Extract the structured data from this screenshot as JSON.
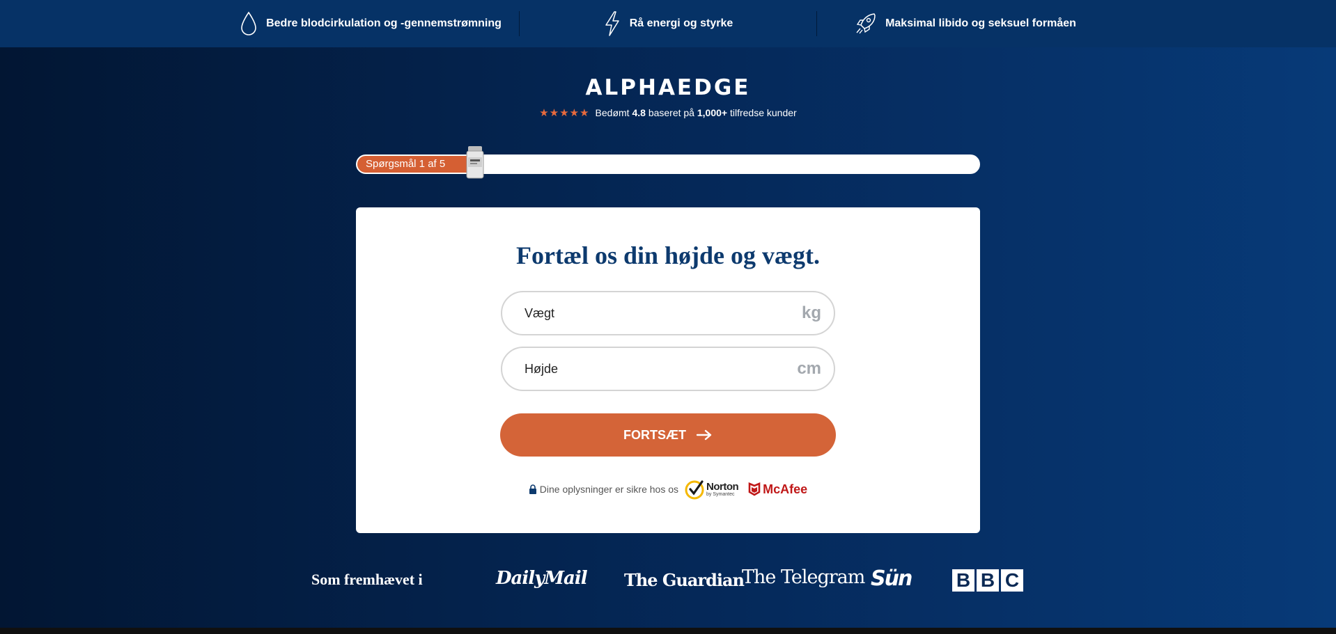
{
  "topbar": {
    "benefits": [
      {
        "icon": "droplet-icon",
        "text": "Bedre blodcirkulation og -gennemstrømning"
      },
      {
        "icon": "lightning-icon",
        "text": "Rå energi og styrke"
      },
      {
        "icon": "rocket-icon",
        "text": "Maksimal libido og seksuel formåen"
      }
    ]
  },
  "brand": {
    "logo": "ALPHAEDGE",
    "rating": {
      "stars": 5,
      "prefix": "Bedømt",
      "score": "4.8",
      "middle": "baseret på",
      "count": "1,000+",
      "suffix": "tilfredse kunder"
    }
  },
  "progress": {
    "label": "Spørgsmål 1 af 5",
    "current": 1,
    "total": 5
  },
  "form": {
    "title": "Fortæl os din højde og vægt.",
    "weight": {
      "placeholder": "Vægt",
      "unit": "kg"
    },
    "height": {
      "placeholder": "Højde",
      "unit": "cm"
    },
    "continue_label": "FORTSÆT",
    "secure_text": "Dine oplysninger er sikre hos os",
    "norton_name": "Norton",
    "norton_sub": "by Symantec",
    "mcafee": "McAfee"
  },
  "featured": {
    "label": "Som fremhævet i",
    "outlets": [
      "DailyMail",
      "The Guardian",
      "The Telegram",
      "Sun",
      "BBC"
    ],
    "sun_label": "Sün",
    "bbc_letters": [
      "B",
      "B",
      "C"
    ]
  },
  "colors": {
    "accent": "#d46438",
    "navy": "#063266",
    "title": "#0d3a6e"
  }
}
